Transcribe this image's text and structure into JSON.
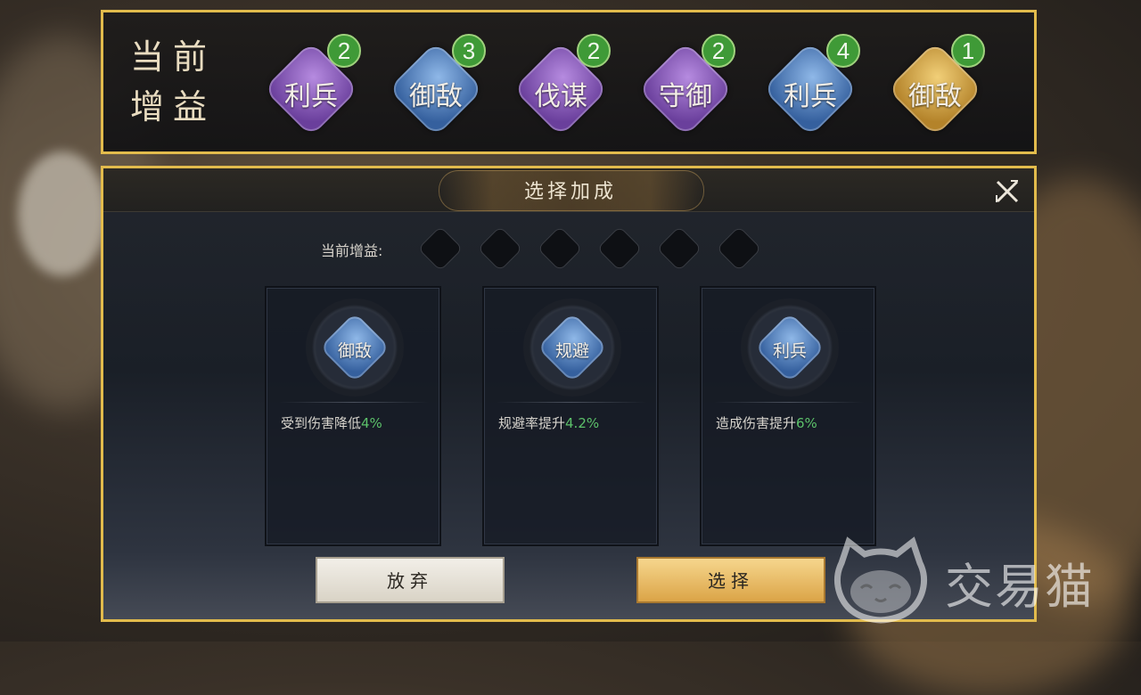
{
  "top_bar": {
    "title_line1": "当前",
    "title_line2": "增益",
    "buffs": [
      {
        "label": "利兵",
        "count": "2",
        "color": "purple"
      },
      {
        "label": "御敌",
        "count": "3",
        "color": "blue"
      },
      {
        "label": "伐谋",
        "count": "2",
        "color": "purple"
      },
      {
        "label": "守御",
        "count": "2",
        "color": "purple"
      },
      {
        "label": "利兵",
        "count": "4",
        "color": "blue"
      },
      {
        "label": "御敌",
        "count": "1",
        "color": "gold"
      }
    ]
  },
  "dialog": {
    "title": "选择加成",
    "close_icon": "close-x-icon",
    "slots_label": "当前增益:",
    "slot_count": 6,
    "cards": [
      {
        "gem_label": "御敌",
        "desc_prefix": "受到伤害降低",
        "desc_value": "4%"
      },
      {
        "gem_label": "规避",
        "desc_prefix": "规避率提升",
        "desc_value": "4.2%"
      },
      {
        "gem_label": "利兵",
        "desc_prefix": "造成伤害提升",
        "desc_value": "6%"
      }
    ],
    "abandon_label": "放弃",
    "select_label": "选择"
  },
  "watermark": {
    "text": "交易猫",
    "icon": "cat-logo-icon"
  },
  "colors": {
    "frame_gold": "#e2bb4c",
    "purple_gem": "#6a3f9c",
    "blue_gem": "#35609e",
    "gold_gem": "#b4832a",
    "count_badge": "#3f9a37",
    "highlight_green": "#5cc16a"
  }
}
